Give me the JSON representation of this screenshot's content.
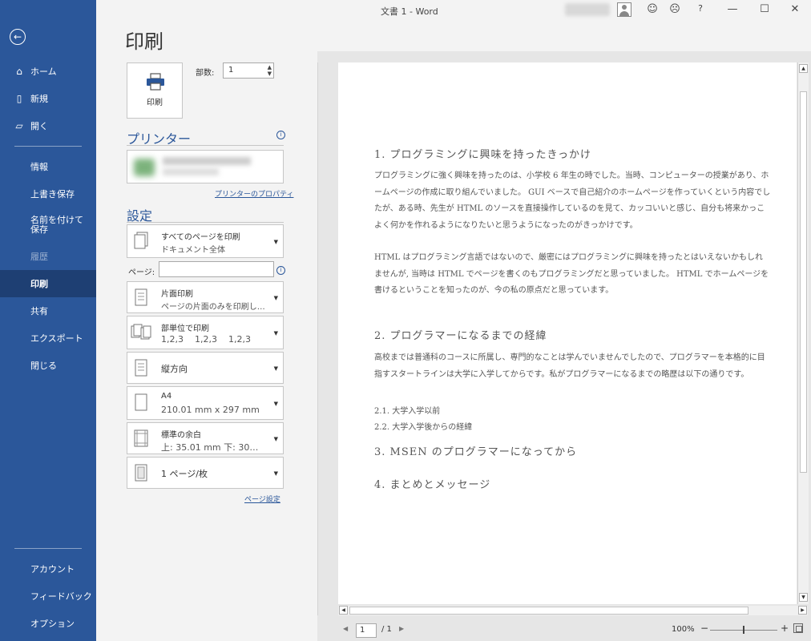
{
  "window": {
    "title": "文書 1  -  Word",
    "help": "?",
    "minimize": "—",
    "maximize": "☐",
    "close": "✕",
    "smile": "☺",
    "frown": "☹"
  },
  "sidebar": {
    "back_icon": "back-arrow-icon",
    "top_items": [
      {
        "label": "ホーム",
        "icon": "home-icon"
      },
      {
        "label": "新規",
        "icon": "new-document-icon"
      },
      {
        "label": "開く",
        "icon": "open-folder-icon"
      }
    ],
    "sub_items": [
      {
        "label": "情報"
      },
      {
        "label": "上書き保存"
      },
      {
        "label": "名前を付けて保存"
      },
      {
        "label": "履歴"
      },
      {
        "label": "印刷"
      },
      {
        "label": "共有"
      },
      {
        "label": "エクスポート"
      },
      {
        "label": "閉じる"
      }
    ],
    "bottom_items": [
      {
        "label": "アカウント"
      },
      {
        "label": "フィードバック"
      },
      {
        "label": "オプション"
      }
    ]
  },
  "print": {
    "heading": "印刷",
    "print_button_label": "印刷",
    "copies_label": "部数:",
    "copies_value": "1",
    "printer_section": "プリンター",
    "printer_properties_link": "プリンターのプロパティ",
    "settings_section": "設定",
    "pages_label": "ページ:",
    "page_setup_link": "ページ設定",
    "dropdowns": [
      {
        "line1": "すべてのページを印刷",
        "line2": "ドキュメント全体"
      },
      {
        "line1": "片面印刷",
        "line2": "ページの片面のみを印刷し…"
      },
      {
        "line1": "部単位で印刷",
        "line2": "1,2,3    1,2,3    1,2,3"
      },
      {
        "line1": "縦方向"
      },
      {
        "line1": "A4",
        "line2": "210.01 mm x 297 mm"
      },
      {
        "line1": "標準の余白",
        "line2": "上: 35.01 mm 下: 30…"
      },
      {
        "line1": "1 ページ/枚"
      }
    ]
  },
  "preview": {
    "h1": "1.   プログラミングに興味を持ったきっかけ",
    "p1": "プログラミングに強く興味を持ったのは、小学校 6 年生の時でした。当時、コンピューターの授業があり、ホームページの作成に取り組んでいました。 GUI ベースで自己紹介のホームページを作っていくという内容でしたが、ある時、先生が HTML のソースを直接操作しているのを見て、カッコいいと感じ、自分も将来かっこよく何かを作れるようになりたいと思うようになったのがきっかけです。",
    "p2": "HTML はプログラミング言語ではないので、厳密にはプログラミングに興味を持ったとはいえないかもしれませんが, 当時は HTML でページを書くのもプログラミングだと思っていました。 HTML でホームページを書けるということを知ったのが、今の私の原点だと思っています。",
    "h2": "2.   プログラマーになるまでの経緯",
    "p3": "高校までは普通科のコースに所属し、専門的なことは学んでいませんでしたので、プログラマーを本格的に目指すスタートラインは大学に入学してからです。私がプログラマーになるまでの略歴は以下の通りです。",
    "s1": "2.1.    大学入学以前",
    "s2": "2.2.    大学入学後からの経緯",
    "h3": "3.   MSEN のプログラマーになってから",
    "h4": "4.   まとめとメッセージ"
  },
  "status": {
    "page_current": "1",
    "page_total": "/ 1",
    "zoom": "100%",
    "zoom_minus": "−",
    "zoom_plus": "+",
    "zoom_level": 0.5
  }
}
